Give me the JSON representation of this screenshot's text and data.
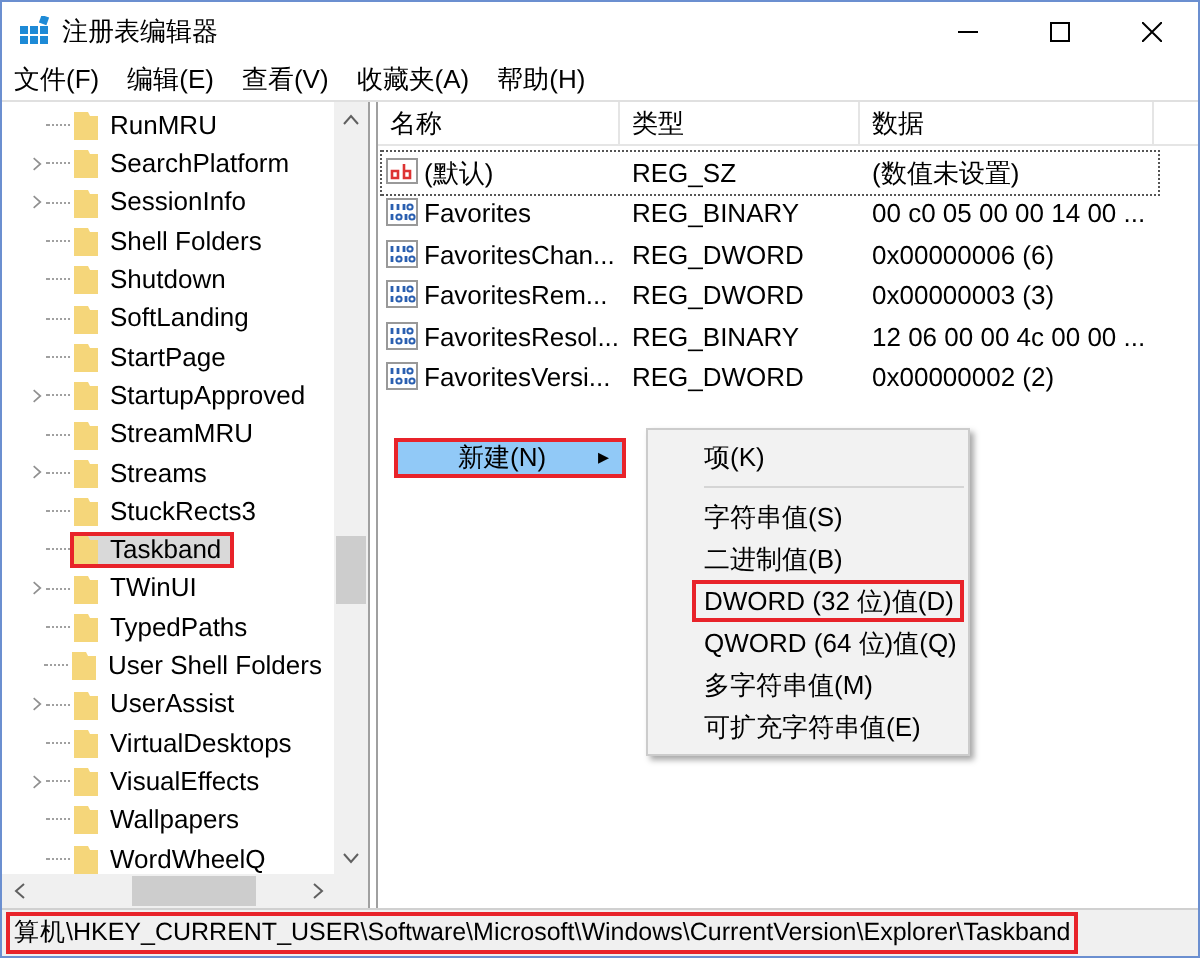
{
  "window": {
    "title": "注册表编辑器"
  },
  "menu_bar": [
    "文件(F)",
    "编辑(E)",
    "查看(V)",
    "收藏夹(A)",
    "帮助(H)"
  ],
  "tree": {
    "items": [
      {
        "label": "RunMRU",
        "expandable": false,
        "selected": false,
        "highlighted": false
      },
      {
        "label": "SearchPlatform",
        "expandable": true,
        "selected": false,
        "highlighted": false
      },
      {
        "label": "SessionInfo",
        "expandable": true,
        "selected": false,
        "highlighted": false
      },
      {
        "label": "Shell Folders",
        "expandable": false,
        "selected": false,
        "highlighted": false
      },
      {
        "label": "Shutdown",
        "expandable": false,
        "selected": false,
        "highlighted": false
      },
      {
        "label": "SoftLanding",
        "expandable": false,
        "selected": false,
        "highlighted": false
      },
      {
        "label": "StartPage",
        "expandable": false,
        "selected": false,
        "highlighted": false
      },
      {
        "label": "StartupApproved",
        "expandable": true,
        "selected": false,
        "highlighted": false
      },
      {
        "label": "StreamMRU",
        "expandable": false,
        "selected": false,
        "highlighted": false
      },
      {
        "label": "Streams",
        "expandable": true,
        "selected": false,
        "highlighted": false
      },
      {
        "label": "StuckRects3",
        "expandable": false,
        "selected": false,
        "highlighted": false
      },
      {
        "label": "Taskband",
        "expandable": false,
        "selected": true,
        "highlighted": true
      },
      {
        "label": "TWinUI",
        "expandable": true,
        "selected": false,
        "highlighted": false
      },
      {
        "label": "TypedPaths",
        "expandable": false,
        "selected": false,
        "highlighted": false
      },
      {
        "label": "User Shell Folders",
        "expandable": false,
        "selected": false,
        "highlighted": false
      },
      {
        "label": "UserAssist",
        "expandable": true,
        "selected": false,
        "highlighted": false
      },
      {
        "label": "VirtualDesktops",
        "expandable": false,
        "selected": false,
        "highlighted": false
      },
      {
        "label": "VisualEffects",
        "expandable": true,
        "selected": false,
        "highlighted": false
      },
      {
        "label": "Wallpapers",
        "expandable": false,
        "selected": false,
        "highlighted": false
      },
      {
        "label": "WordWheelQ",
        "expandable": false,
        "selected": false,
        "highlighted": false
      }
    ]
  },
  "values": {
    "columns": [
      "名称",
      "类型",
      "数据"
    ],
    "rows": [
      {
        "kind": "string",
        "name": "(默认)",
        "type": "REG_SZ",
        "data": "(数值未设置)",
        "focused": true
      },
      {
        "kind": "binary",
        "name": "Favorites",
        "type": "REG_BINARY",
        "data": "00 c0 05 00 00 14 00 ...",
        "focused": false
      },
      {
        "kind": "binary",
        "name": "FavoritesChan...",
        "type": "REG_DWORD",
        "data": "0x00000006 (6)",
        "focused": false
      },
      {
        "kind": "binary",
        "name": "FavoritesRem...",
        "type": "REG_DWORD",
        "data": "0x00000003 (3)",
        "focused": false
      },
      {
        "kind": "binary",
        "name": "FavoritesResol...",
        "type": "REG_BINARY",
        "data": "12 06 00 00 4c 00 00 ...",
        "focused": false
      },
      {
        "kind": "binary",
        "name": "FavoritesVersi...",
        "type": "REG_DWORD",
        "data": "0x00000002 (2)",
        "focused": false
      }
    ]
  },
  "context_menu": {
    "label": "新建(N)",
    "arrow": "▸",
    "highlighted": true,
    "submenu": [
      {
        "label": "项(K)",
        "highlighted": false
      },
      {
        "kind": "separator"
      },
      {
        "label": "字符串值(S)",
        "highlighted": false
      },
      {
        "label": "二进制值(B)",
        "highlighted": false
      },
      {
        "label": "DWORD (32 位)值(D)",
        "highlighted": true
      },
      {
        "label": "QWORD (64 位)值(Q)",
        "highlighted": false
      },
      {
        "label": "多字符串值(M)",
        "highlighted": false
      },
      {
        "label": "可扩充字符串值(E)",
        "highlighted": false
      }
    ]
  },
  "status_bar": {
    "path": "算机\\HKEY_CURRENT_USER\\Software\\Microsoft\\Windows\\CurrentVersion\\Explorer\\Taskband",
    "highlighted": true
  }
}
